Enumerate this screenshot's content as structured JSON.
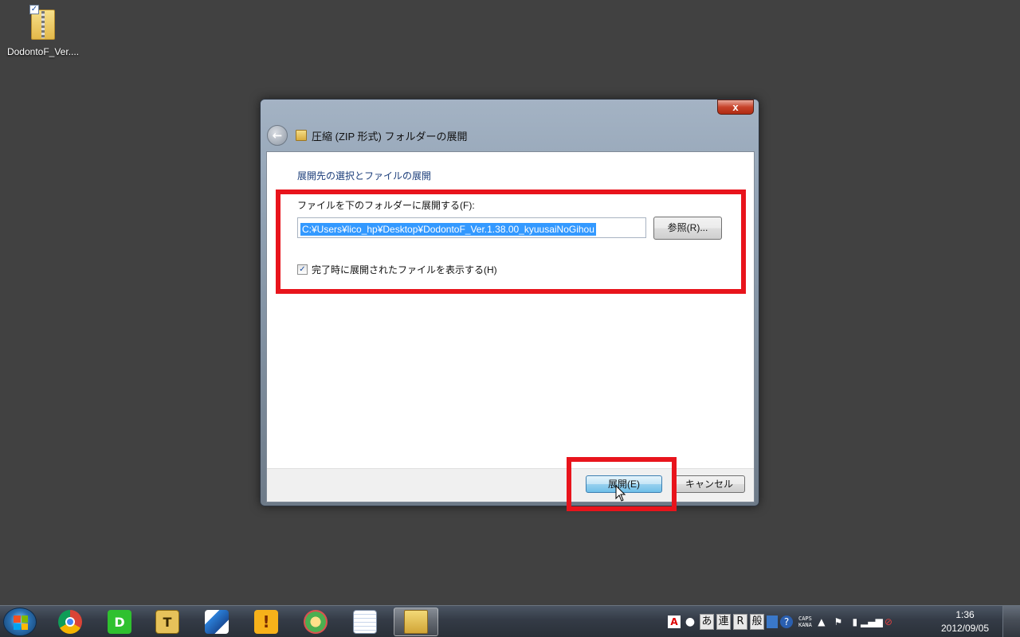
{
  "desktop": {
    "icon_label": "DodontoF_Ver...."
  },
  "dialog": {
    "close_label": "x",
    "title": "圧縮 (ZIP 形式) フォルダーの展開",
    "heading": "展開先の選択とファイルの展開",
    "field_label": "ファイルを下のフォルダーに展開する(F):",
    "path_value": "C:¥Users¥lico_hp¥Desktop¥DodontoF_Ver.1.38.00_kyuusaiNoGihou",
    "browse_label": "参照(R)...",
    "show_files_label": "完了時に展開されたファイルを表示する(H)",
    "show_files_checked": true,
    "extract_label": "展開(E)",
    "cancel_label": "キャンセル"
  },
  "annotation_color": "#e8141c",
  "taskbar": {
    "apps": [
      {
        "name": "chrome-icon",
        "glyph": ""
      },
      {
        "name": "line-app-icon",
        "glyph": "D"
      },
      {
        "name": "text-editor-icon",
        "glyph": "T"
      },
      {
        "name": "feather-pen-icon",
        "glyph": ""
      },
      {
        "name": "exclamation-app-icon",
        "glyph": "!"
      },
      {
        "name": "paint-app-icon",
        "glyph": ""
      },
      {
        "name": "notepad-icon",
        "glyph": ""
      },
      {
        "name": "file-explorer-icon",
        "glyph": ""
      }
    ],
    "ime": [
      "あ",
      "連",
      "R",
      "般"
    ],
    "caps_top": "CAPS",
    "caps_bottom": "KANA",
    "clock_time": "1:36",
    "clock_date": "2012/09/05"
  }
}
